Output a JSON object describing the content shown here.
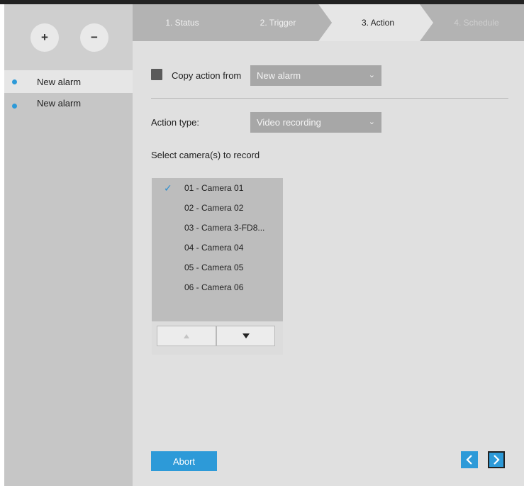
{
  "sidebar": {
    "add_label": "+",
    "remove_label": "−",
    "alarms": [
      {
        "label": "New alarm",
        "selected": true
      },
      {
        "label": "New alarm",
        "selected": false
      }
    ]
  },
  "tabs": [
    {
      "label": "1. Status",
      "state": "done"
    },
    {
      "label": "2. Trigger",
      "state": "done"
    },
    {
      "label": "3. Action",
      "state": "active"
    },
    {
      "label": "4. Schedule",
      "state": "disabled"
    }
  ],
  "copy_action": {
    "label": "Copy action from",
    "checked": false,
    "value": "New alarm"
  },
  "action_type": {
    "label": "Action type:",
    "value": "Video recording"
  },
  "cameras": {
    "heading": "Select camera(s) to record",
    "items": [
      {
        "label": "01 - Camera 01",
        "checked": true
      },
      {
        "label": "02 - Camera 02",
        "checked": false
      },
      {
        "label": "03 - Camera 3-FD8...",
        "checked": false
      },
      {
        "label": "04 - Camera 04",
        "checked": false
      },
      {
        "label": "05 - Camera 05",
        "checked": false
      },
      {
        "label": "06 - Camera 06",
        "checked": false
      }
    ]
  },
  "footer": {
    "abort_label": "Abort"
  },
  "colors": {
    "accent": "#2d9ad8",
    "sidebar_bg": "#c6c6c6",
    "main_bg": "#e0e0e0",
    "tabbar_bg": "#b3b3b3",
    "dropdown_bg": "#a7a7a7"
  }
}
